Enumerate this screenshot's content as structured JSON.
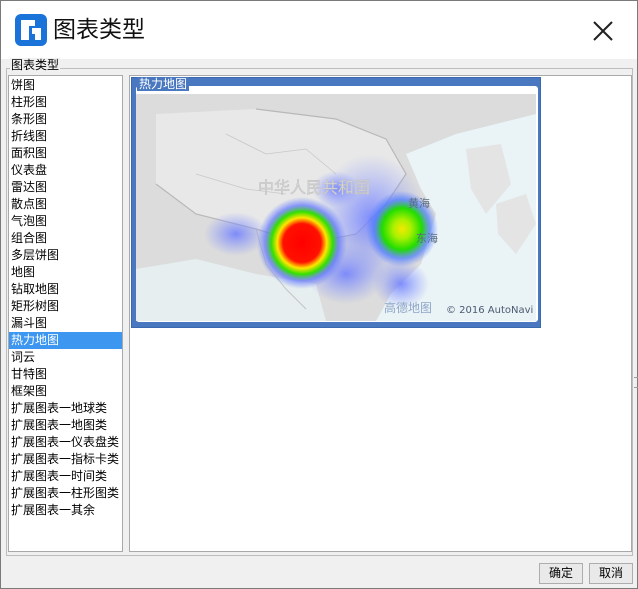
{
  "dialog": {
    "title": "图表类型",
    "group_label": "图表类型"
  },
  "chart_types": [
    "饼图",
    "柱形图",
    "条形图",
    "折线图",
    "面积图",
    "仪表盘",
    "雷达图",
    "散点图",
    "气泡图",
    "组合图",
    "多层饼图",
    "地图",
    "钻取地图",
    "矩形树图",
    "漏斗图",
    "热力地图",
    "词云",
    "甘特图",
    "框架图",
    "扩展图表一地球类",
    "扩展图表一地图类",
    "扩展图表一仪表盘类",
    "扩展图表一指标卡类",
    "扩展图表一时间类",
    "扩展图表一柱形图类",
    "扩展图表一其余"
  ],
  "selected_type": "热力地图",
  "preview": {
    "label": "热力地图",
    "map_labels": {
      "country": "中华人民共和国",
      "sea_yellow": "黄海",
      "sea_east": "东海"
    },
    "brand": "高德地图",
    "copyright": "© 2016 AutoNavi"
  },
  "buttons": {
    "ok": "确定",
    "cancel": "取消"
  },
  "colors": {
    "selection": "#3d96f0",
    "preview_frame": "#4a78c0"
  },
  "icons": {
    "logo": "app-logo-icon",
    "close": "close-icon"
  }
}
